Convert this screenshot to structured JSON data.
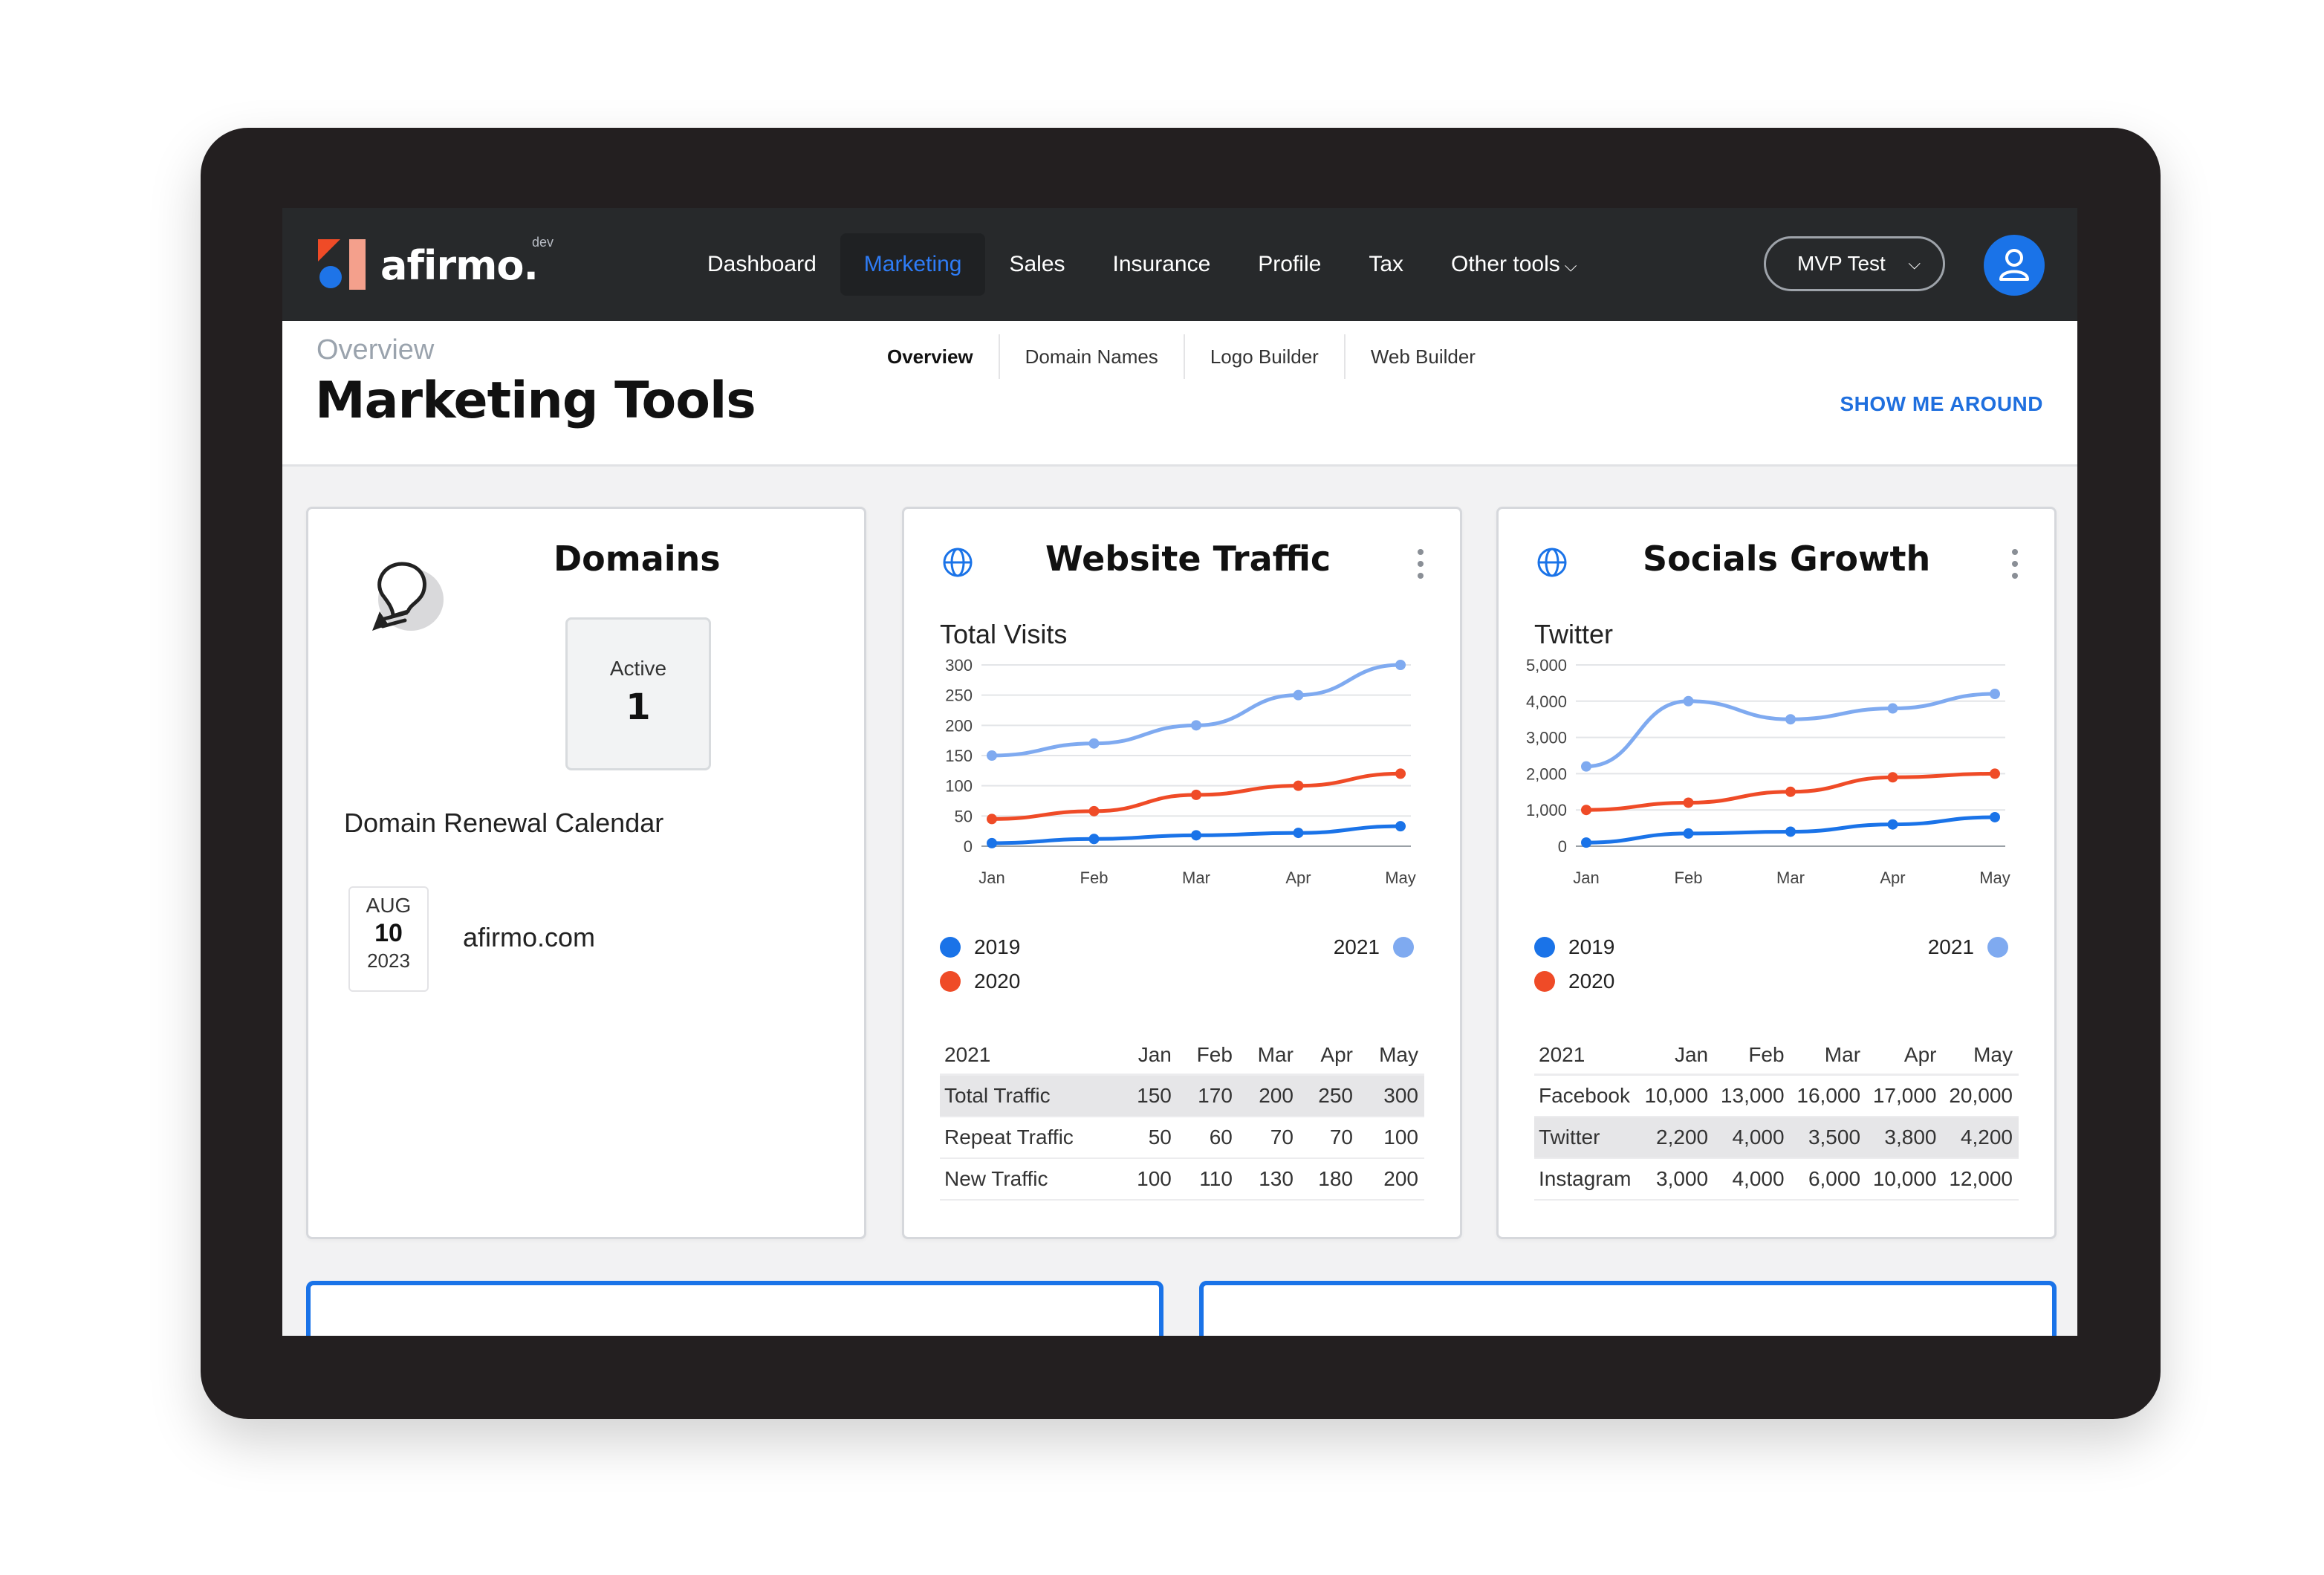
{
  "brand": {
    "name": "afirmo.",
    "badge": "dev",
    "accent": "#1a73e8",
    "dark": "#27292b"
  },
  "nav": {
    "items": [
      "Dashboard",
      "Marketing",
      "Sales",
      "Insurance",
      "Profile",
      "Tax",
      "Other tools"
    ],
    "active": "Marketing",
    "workspace": "MVP Test"
  },
  "page": {
    "crumb": "Overview",
    "title": "Marketing Tools",
    "tabs": [
      "Overview",
      "Domain Names",
      "Logo Builder",
      "Web Builder"
    ],
    "tour_link": "SHOW ME AROUND"
  },
  "domains": {
    "title": "Domains",
    "active_label": "Active",
    "active_count": "1",
    "renewal_title": "Domain Renewal Calendar",
    "renewal": {
      "month": "AUG",
      "day": "10",
      "year": "2023",
      "domain": "afirmo.com"
    }
  },
  "traffic": {
    "title": "Website Traffic",
    "subtitle": "Total Visits",
    "legend": [
      "2019",
      "2020",
      "2021"
    ],
    "table": {
      "header": [
        "2021",
        "Jan",
        "Feb",
        "Mar",
        "Apr",
        "May"
      ],
      "rows": [
        [
          "Total Traffic",
          "150",
          "170",
          "200",
          "250",
          "300"
        ],
        [
          "Repeat Traffic",
          "50",
          "60",
          "70",
          "70",
          "100"
        ],
        [
          "New Traffic",
          "100",
          "110",
          "130",
          "180",
          "200"
        ]
      ]
    }
  },
  "socials": {
    "title": "Socials Growth",
    "subtitle": "Twitter",
    "legend": [
      "2019",
      "2020",
      "2021"
    ],
    "table": {
      "header": [
        "2021",
        "Jan",
        "Feb",
        "Mar",
        "Apr",
        "May"
      ],
      "rows": [
        [
          "Facebook",
          "10,000",
          "13,000",
          "16,000",
          "17,000",
          "20,000"
        ],
        [
          "Twitter",
          "2,200",
          "4,000",
          "3,500",
          "3,800",
          "4,200"
        ],
        [
          "Instagram",
          "3,000",
          "4,000",
          "6,000",
          "10,000",
          "12,000"
        ]
      ]
    }
  },
  "chart_data": [
    {
      "type": "line",
      "title": "Total Visits",
      "categories": [
        "Jan",
        "Feb",
        "Mar",
        "Apr",
        "May"
      ],
      "ylim": [
        0,
        300
      ],
      "yticks": [
        "0",
        "50",
        "100",
        "150",
        "200",
        "250",
        "300"
      ],
      "grid": true,
      "series": [
        {
          "name": "2019",
          "color": "#1a73e8",
          "values": [
            5,
            12,
            18,
            22,
            33
          ]
        },
        {
          "name": "2020",
          "color": "#ef4b27",
          "values": [
            45,
            58,
            85,
            100,
            120
          ]
        },
        {
          "name": "2021",
          "color": "#7faaf0",
          "values": [
            150,
            170,
            200,
            250,
            300
          ]
        }
      ]
    },
    {
      "type": "line",
      "title": "Twitter",
      "categories": [
        "Jan",
        "Feb",
        "Mar",
        "Apr",
        "May"
      ],
      "ylim": [
        0,
        5000
      ],
      "yticks": [
        "0",
        "1,000",
        "2,000",
        "3,000",
        "4,000",
        "5,000"
      ],
      "grid": true,
      "series": [
        {
          "name": "2019",
          "color": "#1a73e8",
          "values": [
            100,
            350,
            400,
            600,
            800
          ]
        },
        {
          "name": "2020",
          "color": "#ef4b27",
          "values": [
            1000,
            1200,
            1500,
            1900,
            2000
          ]
        },
        {
          "name": "2021",
          "color": "#7faaf0",
          "values": [
            2200,
            4000,
            3500,
            3800,
            4200
          ]
        }
      ]
    }
  ]
}
